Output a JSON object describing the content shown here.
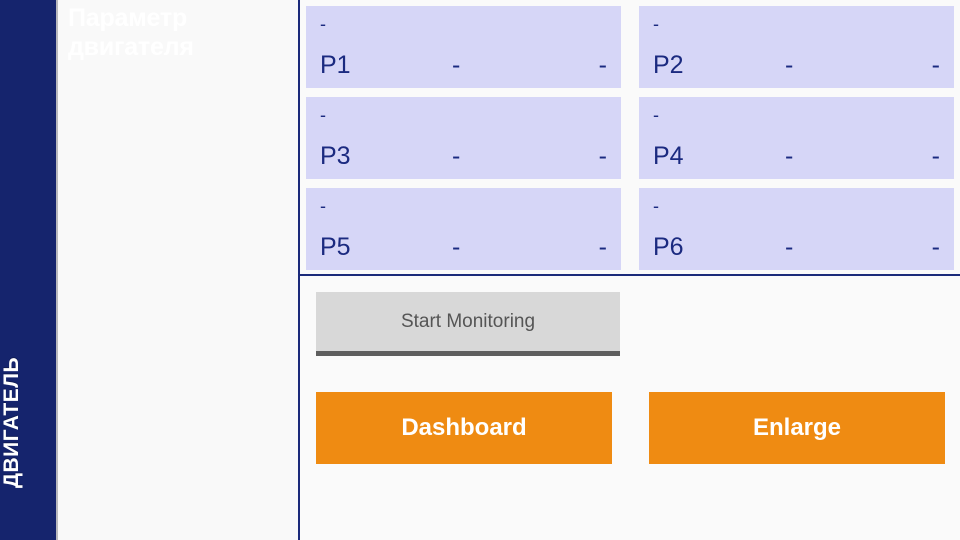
{
  "rail": {
    "label": "ДВИГАТЕЛЬ"
  },
  "side_panel": {
    "title": "Параметр двигателя"
  },
  "parameters": [
    {
      "unit": "-",
      "name": "P1",
      "mid": "-",
      "right": "-"
    },
    {
      "unit": "-",
      "name": "P2",
      "mid": "-",
      "right": "-"
    },
    {
      "unit": "-",
      "name": "P3",
      "mid": "-",
      "right": "-"
    },
    {
      "unit": "-",
      "name": "P4",
      "mid": "-",
      "right": "-"
    },
    {
      "unit": "-",
      "name": "P5",
      "mid": "-",
      "right": "-"
    },
    {
      "unit": "-",
      "name": "P6",
      "mid": "-",
      "right": "-"
    }
  ],
  "actions": {
    "start_monitoring": "Start Monitoring",
    "dashboard": "Dashboard",
    "enlarge": "Enlarge"
  },
  "colors": {
    "rail_navy": "#15246d",
    "divider_navy": "#1b2a7a",
    "card_lavender": "#d6d6f7",
    "card_text": "#1b2a80",
    "orange": "#ef8b12",
    "monitor_gray": "#d8d8d8",
    "monitor_underline": "#5e5e5e",
    "panel_bg": "#f9f9f9"
  }
}
